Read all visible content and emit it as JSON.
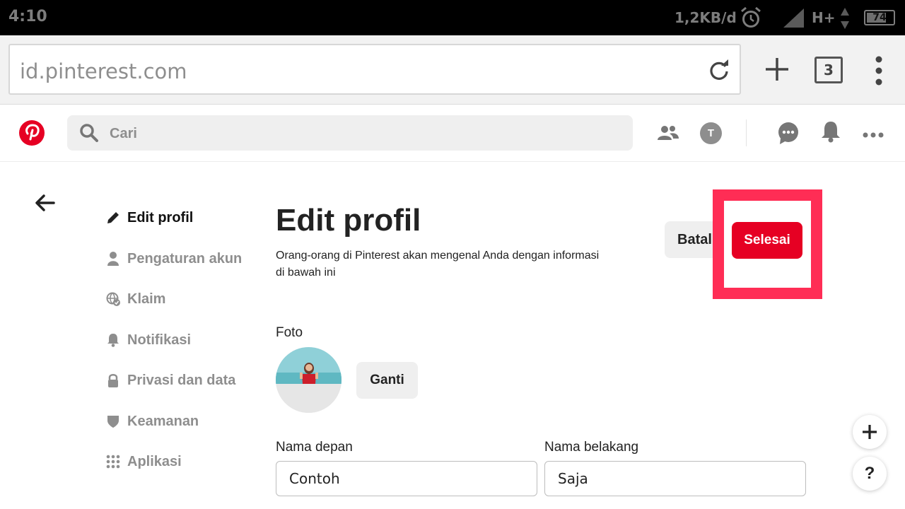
{
  "status_bar": {
    "time": "4:10",
    "net_speed": "1,2KB/d",
    "network_type": "H+",
    "battery_percent": 74
  },
  "browser": {
    "url": "id.pinterest.com",
    "tab_count": "3"
  },
  "header": {
    "search_placeholder": "Cari",
    "user_initial": "T"
  },
  "sidebar": {
    "items": [
      {
        "label": "Edit profil",
        "icon": "pencil-icon",
        "active": true
      },
      {
        "label": "Pengaturan akun",
        "icon": "person-icon",
        "active": false
      },
      {
        "label": "Klaim",
        "icon": "globe-check-icon",
        "active": false
      },
      {
        "label": "Notifikasi",
        "icon": "bell-icon",
        "active": false
      },
      {
        "label": "Privasi dan data",
        "icon": "lock-icon",
        "active": false
      },
      {
        "label": "Keamanan",
        "icon": "shield-icon",
        "active": false
      },
      {
        "label": "Aplikasi",
        "icon": "grid-icon",
        "active": false
      }
    ]
  },
  "main": {
    "title": "Edit profil",
    "description": "Orang-orang di Pinterest akan mengenal Anda dengan informasi di bawah ini",
    "cancel_label": "Batal",
    "done_label": "Selesai",
    "photo_label": "Foto",
    "change_label": "Ganti",
    "first_name_label": "Nama depan",
    "first_name_value": "Contoh",
    "last_name_label": "Nama belakang",
    "last_name_value": "Saja"
  },
  "colors": {
    "brand_red": "#e60023",
    "highlight": "#ff2d55"
  }
}
